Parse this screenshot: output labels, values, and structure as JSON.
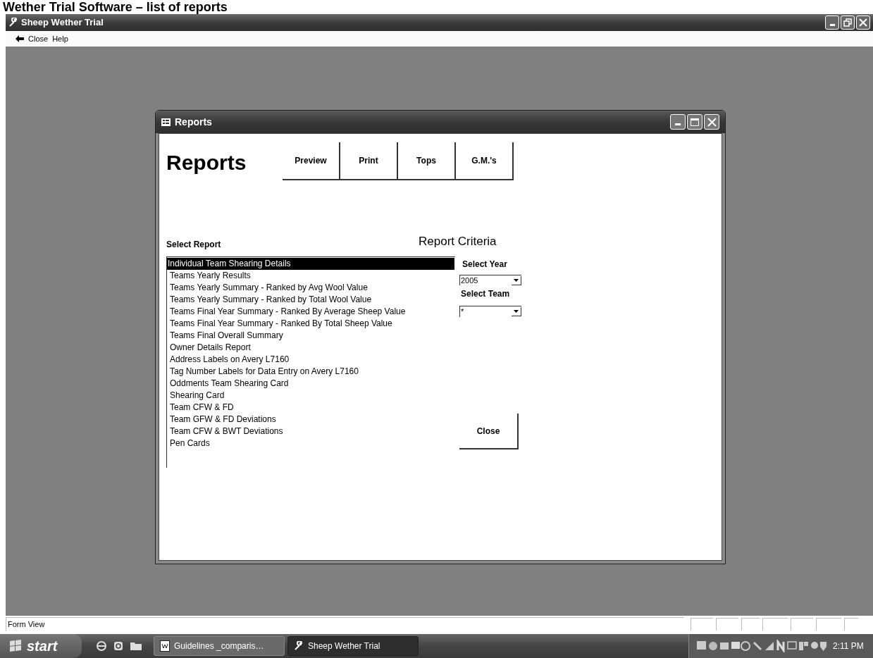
{
  "page_heading": "Wether Trial Software – list of reports",
  "app_window": {
    "title": "Sheep Wether Trial"
  },
  "menu": [
    {
      "label": "Close",
      "kind": "back"
    },
    {
      "label": "Help",
      "kind": "plain"
    }
  ],
  "reports_window": {
    "title": "Reports",
    "heading": "Reports",
    "toolbar": [
      {
        "label": "Preview"
      },
      {
        "label": "Print"
      },
      {
        "label": "Tops"
      },
      {
        "label": "G.M.'s"
      }
    ],
    "select_report_label": "Select Report",
    "reports": [
      {
        "label": "Individual Team Shearing Details",
        "selected": true
      },
      {
        "label": "Teams Yearly Results",
        "selected": false
      },
      {
        "label": "Teams Yearly Summary - Ranked by Avg Wool Value",
        "selected": false
      },
      {
        "label": "Teams Yearly Summary - Ranked by Total Wool Value",
        "selected": false
      },
      {
        "label": "Teams Final Year Summary - Ranked By Average Sheep Value",
        "selected": false
      },
      {
        "label": "Teams Final Year Summary - Ranked By Total Sheep Value",
        "selected": false
      },
      {
        "label": "Teams Final Overall Summary",
        "selected": false
      },
      {
        "label": "Owner Details Report",
        "selected": false
      },
      {
        "label": "Address Labels on Avery L7160",
        "selected": false
      },
      {
        "label": "Tag Number Labels for Data Entry on Avery L7160",
        "selected": false
      },
      {
        "label": "Oddments Team Shearing Card",
        "selected": false
      },
      {
        "label": "Shearing Card",
        "selected": false
      },
      {
        "label": "Team CFW & FD",
        "selected": false
      },
      {
        "label": "Team GFW & FD Deviations",
        "selected": false
      },
      {
        "label": "Team CFW & BWT Deviations",
        "selected": false
      },
      {
        "label": "Pen Cards",
        "selected": false
      }
    ],
    "criteria_heading": "Report Criteria",
    "year": {
      "label": "Select Year",
      "value": "2005"
    },
    "team": {
      "label": "Select Team",
      "value": "*"
    },
    "close_button": {
      "label": "Close"
    }
  },
  "status_bar": {
    "text": "Form View"
  },
  "taskbar": {
    "start": "start",
    "tasks": [
      {
        "label": "Guidelines _comparis…",
        "kind": "document",
        "selected": false
      },
      {
        "label": "Sheep Wether Trial",
        "kind": "app",
        "selected": true
      }
    ],
    "clock": "2:11 PM"
  }
}
